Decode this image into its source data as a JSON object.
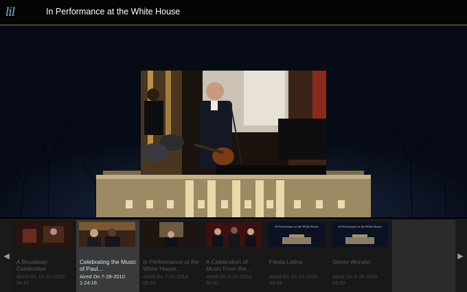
{
  "header": {
    "logo_text": "lil",
    "title": "In Performance at the White House"
  },
  "carousel": {
    "items": [
      {
        "title": "A Broadway Celebration",
        "aired": "Aired On 10-20-2010",
        "duration": "56:51",
        "selected": false
      },
      {
        "title": "Celebrating the Music of Paul...",
        "aired": "Aired On 7-28-2010",
        "duration": "1:24:16",
        "selected": true
      },
      {
        "title": "In Performance at the White House...",
        "aired": "Aired On 7-20-2010",
        "duration": "00:32",
        "selected": false
      },
      {
        "title": "A Celebration of Music From the...",
        "aired": "Aired On 2-10-2010",
        "duration": "56:51",
        "selected": false
      },
      {
        "title": "Fiesta Latina",
        "aired": "Aired On 10-15-2009",
        "duration": "56:48",
        "selected": false
      },
      {
        "title": "Stevie Wonder",
        "aired": "Aired On 2-25-2009",
        "duration": "56:50",
        "selected": false
      }
    ],
    "thumb_caption": "In Performance at the White House"
  },
  "colors": {
    "accent": "#7fb6cf",
    "header_rule": "#8a8258",
    "selected_item_bg": "#3a3a3a"
  }
}
